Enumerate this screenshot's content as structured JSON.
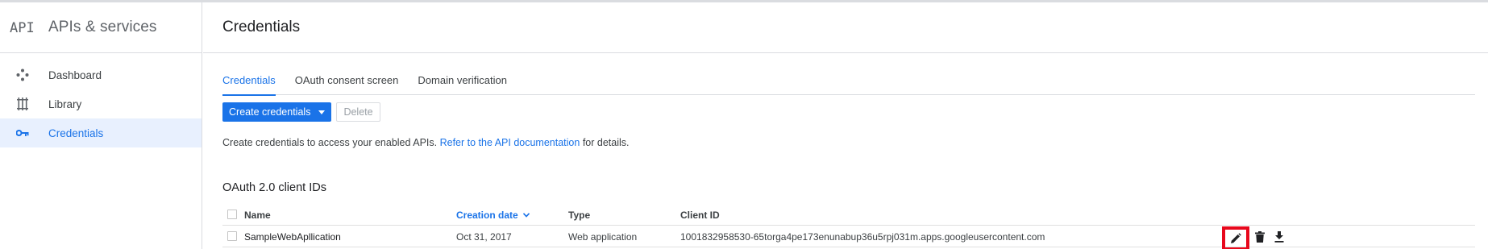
{
  "sidebar": {
    "logo_text": "API",
    "title": "APIs & services",
    "items": [
      {
        "label": "Dashboard",
        "icon": "dashboard-icon",
        "active": false
      },
      {
        "label": "Library",
        "icon": "library-icon",
        "active": false
      },
      {
        "label": "Credentials",
        "icon": "key-icon",
        "active": true
      }
    ]
  },
  "header": {
    "title": "Credentials"
  },
  "tabs": [
    {
      "label": "Credentials",
      "active": true
    },
    {
      "label": "OAuth consent screen",
      "active": false
    },
    {
      "label": "Domain verification",
      "active": false
    }
  ],
  "toolbar": {
    "create_label": "Create credentials",
    "delete_label": "Delete"
  },
  "info": {
    "prefix": "Create credentials to access your enabled APIs.",
    "link": "Refer to the API documentation",
    "suffix": "for details."
  },
  "oauth_section": {
    "title": "OAuth 2.0 client IDs",
    "columns": {
      "name": "Name",
      "creation_date": "Creation date",
      "type": "Type",
      "client_id": "Client ID"
    },
    "rows": [
      {
        "name": "SampleWebApllication",
        "creation_date": "Oct 31, 2017",
        "type": "Web application",
        "client_id": "1001832958530-65torga4pe173enunabup36u5rpj031m.apps.googleusercontent.com"
      }
    ]
  },
  "colors": {
    "accent": "#1a73e8",
    "highlight": "#e8081c",
    "active_bg": "#e8f0fe"
  }
}
